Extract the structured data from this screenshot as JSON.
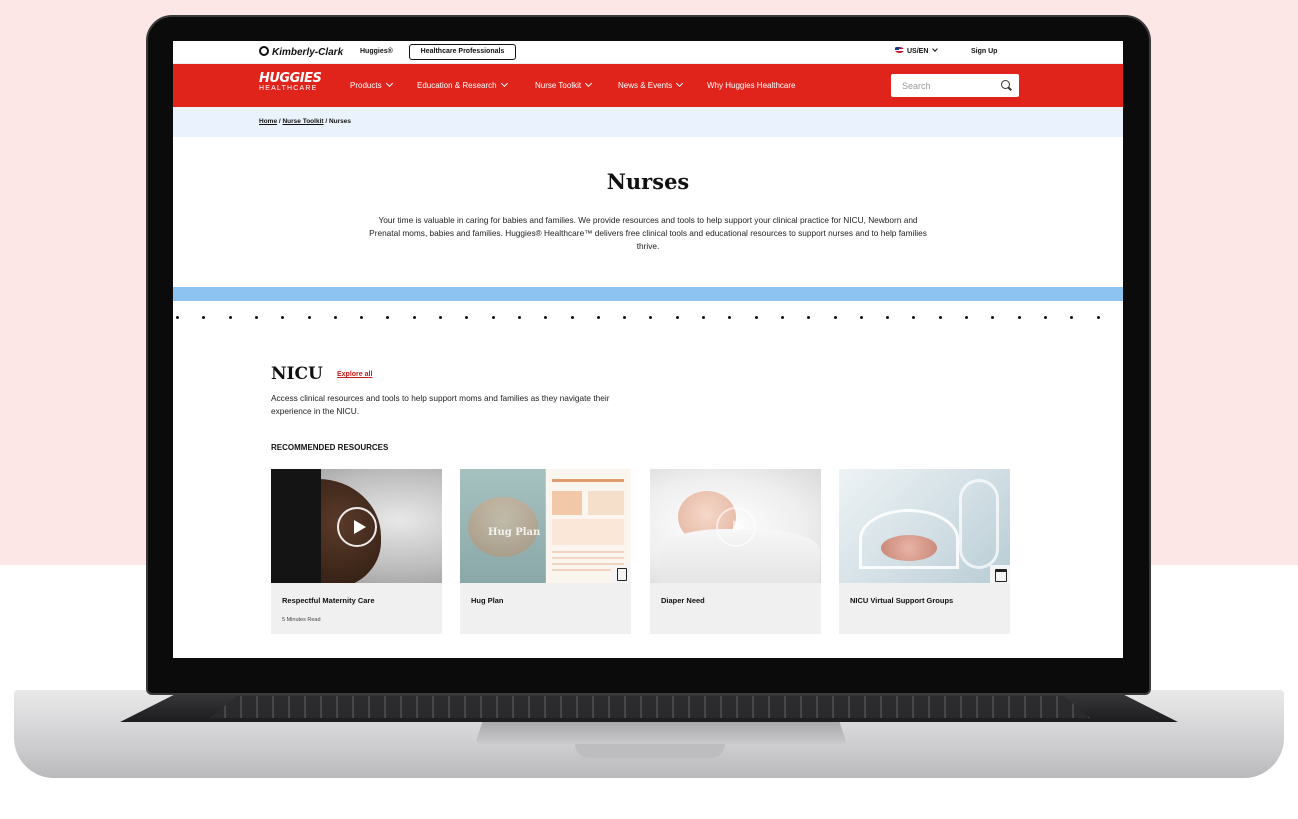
{
  "utility": {
    "brand_logo": "Kimberly-Clark",
    "huggies_link": "Huggies®",
    "hcp_button": "Healthcare Professionals",
    "locale": "US/EN",
    "signup": "Sign Up"
  },
  "nav": {
    "brand_main": "HUGGIES",
    "brand_sub": "HEALTHCARE",
    "items": [
      {
        "label": "Products",
        "dropdown": true
      },
      {
        "label": "Education & Research",
        "dropdown": true
      },
      {
        "label": "Nurse Toolkit",
        "dropdown": true
      },
      {
        "label": "News & Events",
        "dropdown": true
      },
      {
        "label": "Why Huggies Healthcare",
        "dropdown": false
      }
    ],
    "search_placeholder": "Search",
    "accent": "#e0231b"
  },
  "breadcrumb": {
    "home": "Home",
    "sep1": " / ",
    "toolkit": "Nurse Toolkit",
    "sep2": " / ",
    "current": "Nurses"
  },
  "hero": {
    "title": "Nurses",
    "text": "Your time is valuable in caring for babies and families. We provide resources and tools to help support your clinical practice for NICU, Newborn and Prenatal moms, babies and families. Huggies® Healthcare™ delivers free clinical tools and educational resources to support nurses and to help families thrive."
  },
  "nicu": {
    "title": "NICU",
    "explore": "Explore all",
    "desc": "Access clinical resources and tools to help support moms and families as they navigate their experience in the NICU.",
    "recommended_label": "RECOMMENDED RESOURCES",
    "cards": [
      {
        "title": "Respectful Maternity Care",
        "meta": "5 Minutes Read",
        "icon": "play-icon"
      },
      {
        "title": "Hug Plan",
        "meta": "",
        "icon": "pdf-icon",
        "image_text": "Hug Plan"
      },
      {
        "title": "Diaper Need",
        "meta": "",
        "icon": "play-icon"
      },
      {
        "title": "NICU Virtual Support Groups",
        "meta": "",
        "icon": "calendar-icon"
      }
    ]
  }
}
